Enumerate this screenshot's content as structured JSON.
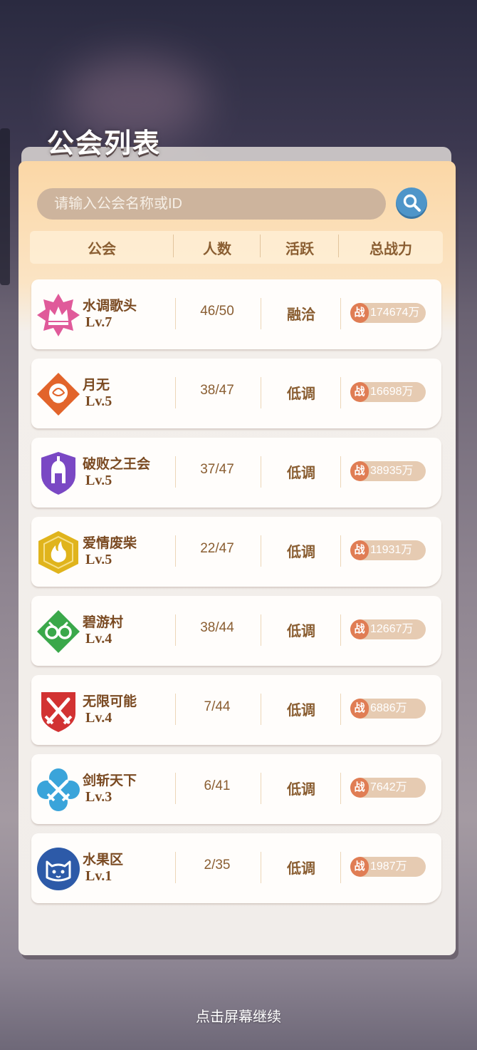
{
  "title": "公会列表",
  "search": {
    "placeholder": "请输入公会名称或ID",
    "value": "",
    "button_icon": "search-icon"
  },
  "columns": [
    "公会",
    "人数",
    "活跃",
    "总战力"
  ],
  "power_icon_label": "战",
  "guilds": [
    {
      "name": "水调歌头",
      "level": "Lv.7",
      "members": "46/50",
      "activity": "融洽",
      "power": "174674万",
      "badge_icon": "crown-icon",
      "badge_color": "#e05a9a"
    },
    {
      "name": "月无",
      "level": "Lv.5",
      "members": "38/47",
      "activity": "低调",
      "power": "16698万",
      "badge_icon": "rose-icon",
      "badge_color": "#e2642b"
    },
    {
      "name": "破败之王会",
      "level": "Lv.5",
      "members": "37/47",
      "activity": "低调",
      "power": "38935万",
      "badge_icon": "spartan-helmet-icon",
      "badge_color": "#7a48c4"
    },
    {
      "name": "爱情废柴",
      "level": "Lv.5",
      "members": "22/47",
      "activity": "低调",
      "power": "11931万",
      "badge_icon": "flame-icon",
      "badge_color": "#e0b41c"
    },
    {
      "name": "碧游村",
      "level": "Lv.4",
      "members": "38/44",
      "activity": "低调",
      "power": "12667万",
      "badge_icon": "glasses-icon",
      "badge_color": "#3aa84a"
    },
    {
      "name": "无限可能",
      "level": "Lv.4",
      "members": "7/44",
      "activity": "低调",
      "power": "6886万",
      "badge_icon": "crossed-swords-icon",
      "badge_color": "#d23232"
    },
    {
      "name": "剑斩天下",
      "level": "Lv.3",
      "members": "6/41",
      "activity": "低调",
      "power": "7642万",
      "badge_icon": "crossed-swords-icon",
      "badge_color": "#3aa4da"
    },
    {
      "name": "水果区",
      "level": "Lv.1",
      "members": "2/35",
      "activity": "低调",
      "power": "1987万",
      "badge_icon": "cat-face-icon",
      "badge_color": "#2d5aa8"
    }
  ],
  "footer_hint": "点击屏幕继续"
}
